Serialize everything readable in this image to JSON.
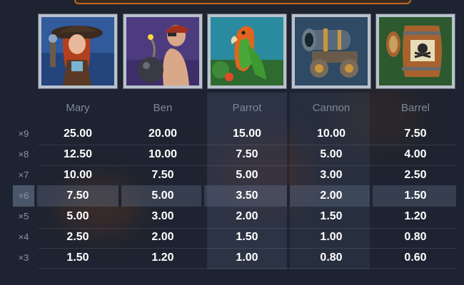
{
  "symbols": [
    {
      "name": "Mary",
      "icon": "pirate-woman-icon",
      "bg": "#2b4a86"
    },
    {
      "name": "Ben",
      "icon": "pirate-bomb-icon",
      "bg": "#4a3a78"
    },
    {
      "name": "Parrot",
      "icon": "parrot-icon",
      "bg": "#2d8a9a"
    },
    {
      "name": "Cannon",
      "icon": "cannon-icon",
      "bg": "#35506a"
    },
    {
      "name": "Barrel",
      "icon": "barrel-icon",
      "bg": "#2f5a32"
    }
  ],
  "rows": [
    {
      "multiplier": "×9",
      "values": [
        "25.00",
        "20.00",
        "15.00",
        "10.00",
        "7.50"
      ]
    },
    {
      "multiplier": "×8",
      "values": [
        "12.50",
        "10.00",
        "7.50",
        "5.00",
        "4.00"
      ]
    },
    {
      "multiplier": "×7",
      "values": [
        "10.00",
        "7.50",
        "5.00",
        "3.00",
        "2.50"
      ]
    },
    {
      "multiplier": "×6",
      "values": [
        "7.50",
        "5.00",
        "3.50",
        "2.00",
        "1.50"
      ]
    },
    {
      "multiplier": "×5",
      "values": [
        "5.00",
        "3.00",
        "2.00",
        "1.50",
        "1.20"
      ]
    },
    {
      "multiplier": "×4",
      "values": [
        "2.50",
        "2.00",
        "1.50",
        "1.00",
        "0.80"
      ]
    },
    {
      "multiplier": "×3",
      "values": [
        "1.50",
        "1.20",
        "1.00",
        "0.80",
        "0.60"
      ]
    }
  ],
  "highlighted_row": "×6",
  "colors": {
    "background": "#1d2330",
    "frame": "#b9c2cc",
    "value_text": "#ffffff",
    "label_text": "#7f8797"
  }
}
